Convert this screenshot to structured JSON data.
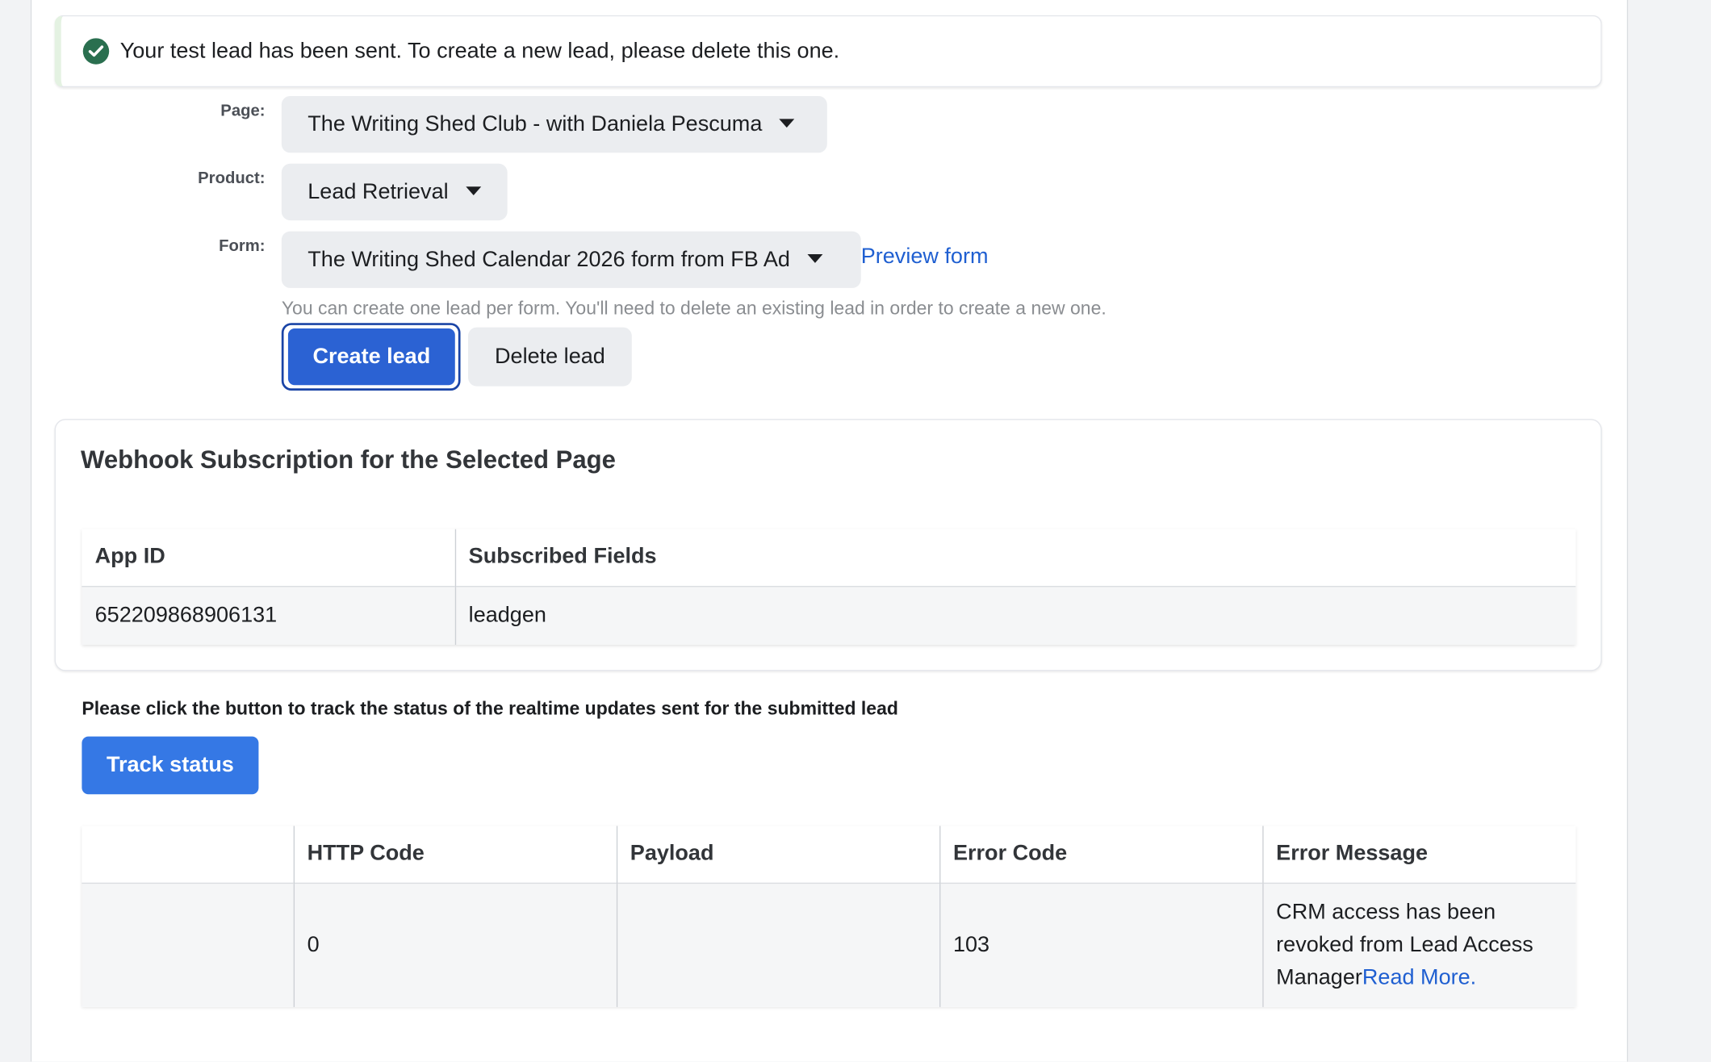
{
  "banner": {
    "message": "Your test lead has been sent. To create a new lead, please delete this one.",
    "icon": "check-circle-icon",
    "color": "#2a6f4f"
  },
  "form": {
    "page_label": "Page:",
    "page_value": "The Writing Shed Club - with Daniela Pescuma",
    "product_label": "Product:",
    "product_value": "Lead Retrieval",
    "form_label": "Form:",
    "form_value": "The Writing Shed Calendar 2026 form from FB Ad",
    "preview_link": "Preview form",
    "hint": "You can create one lead per form. You'll need to delete an existing lead in order to create a new one.",
    "create_button": "Create lead",
    "delete_button": "Delete lead"
  },
  "webhook": {
    "title": "Webhook Subscription for the Selected Page",
    "columns": [
      "App ID",
      "Subscribed Fields"
    ],
    "rows": [
      [
        "652209868906131",
        "leadgen"
      ]
    ]
  },
  "tracking": {
    "instruction": "Please click the button to track the status of the realtime updates sent for the submitted lead",
    "button": "Track status",
    "columns": [
      "",
      "HTTP Code",
      "Payload",
      "Error Code",
      "Error Message"
    ],
    "rows": [
      {
        "first": "",
        "http_code": "0",
        "payload": "",
        "error_code": "103",
        "error_message": "CRM access has been revoked from Lead Access Manager",
        "read_more": "Read More."
      }
    ]
  },
  "colors": {
    "primary": "#2b62d3",
    "track_button": "#3578e5",
    "link": "#1f5fd1"
  }
}
